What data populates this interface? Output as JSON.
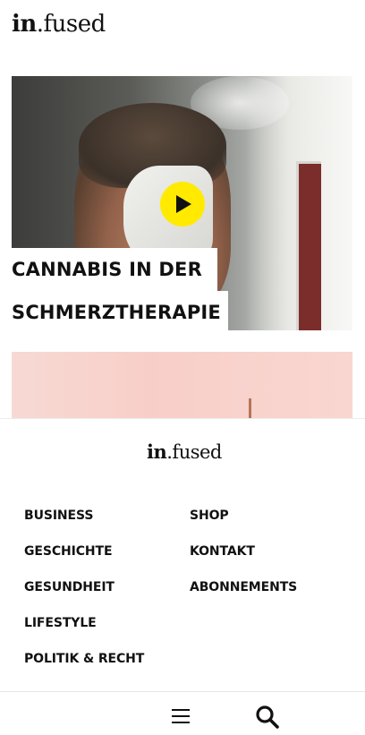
{
  "header": {
    "logo_bold": "in",
    "logo_regular": ".fused"
  },
  "hero": {
    "title_line1": "CANNABIS IN DER",
    "title_line2": "SCHMERZTHERAPIE",
    "play_icon": "play-icon",
    "play_color": "#ffea00"
  },
  "footer": {
    "logo_bold": "in",
    "logo_regular": ".fused",
    "nav_left": [
      "BUSINESS",
      "GESCHICHTE",
      "GESUNDHEIT",
      "LIFESTYLE",
      "POLITIK & RECHT"
    ],
    "nav_right": [
      "SHOP",
      "KONTAKT",
      "ABONNEMENTS"
    ]
  },
  "bottom_bar": {
    "menu_icon": "hamburger-menu-icon",
    "search_icon": "search-icon"
  }
}
